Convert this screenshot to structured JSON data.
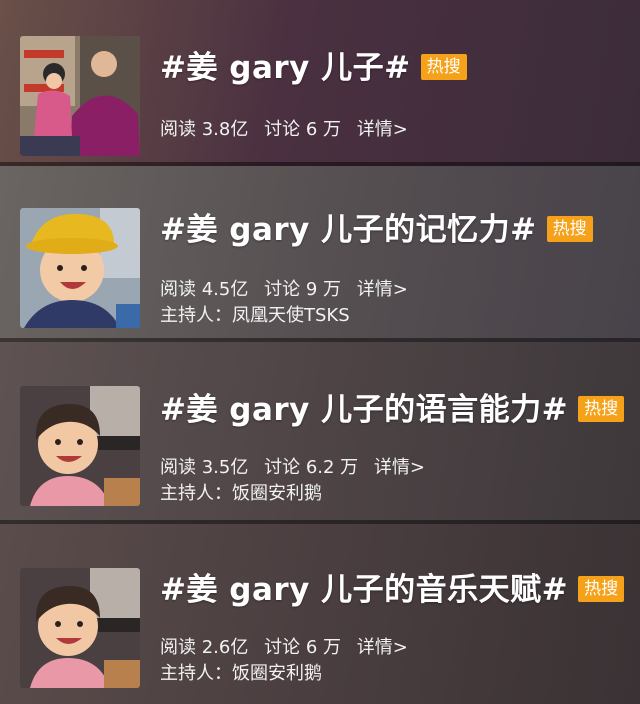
{
  "topics": [
    {
      "title": "#姜 gary 儿子#",
      "badge": "热搜",
      "reads_label": "阅读 3.8亿",
      "discuss_label": "讨论 6 万",
      "details_label": "详情>",
      "host_label": ""
    },
    {
      "title": "#姜 gary 儿子的记忆力#",
      "badge": "热搜",
      "reads_label": "阅读 4.5亿",
      "discuss_label": "讨论 9 万",
      "details_label": "详情>",
      "host_label": "主持人：凤凰天使TSKS"
    },
    {
      "title": "#姜 gary 儿子的语言能力#",
      "badge": "热搜",
      "reads_label": "阅读 3.5亿",
      "discuss_label": "讨论 6.2 万",
      "details_label": "详情>",
      "host_label": "主持人：饭圈安利鹅"
    },
    {
      "title": "#姜 gary 儿子的音乐天赋#",
      "badge": "热搜",
      "reads_label": "阅读 2.6亿",
      "discuss_label": "讨论 6 万",
      "details_label": "详情>",
      "host_label": "主持人：饭圈安利鹅"
    }
  ],
  "colors": {
    "badge": "#f5a21a",
    "card1_bg": "#4a3040",
    "card2_bg": "#565052",
    "card3_bg": "#4e4446",
    "card4_bg": "#4a3e40"
  }
}
